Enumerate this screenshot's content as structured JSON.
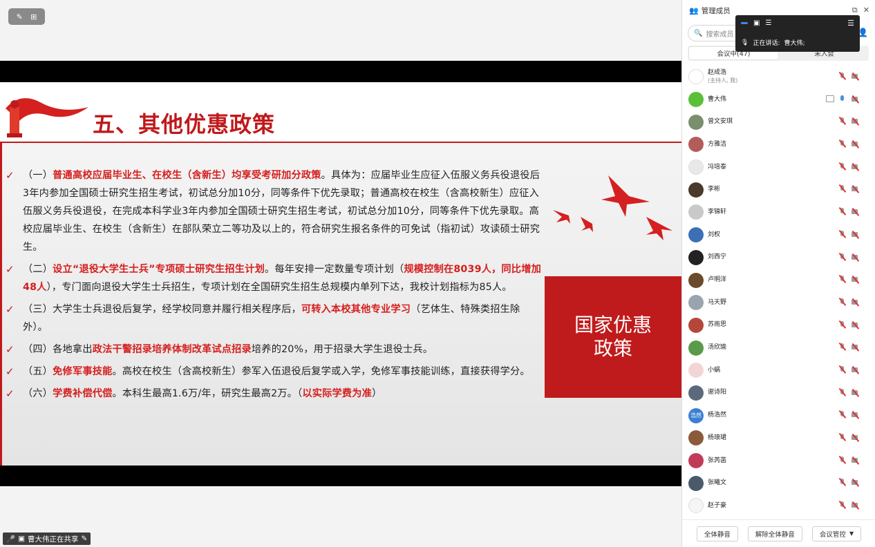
{
  "toolbar": {
    "icon1": "annotate-icon",
    "icon2": "translate-icon"
  },
  "slide": {
    "title": "五、其他优惠政策",
    "redbox_text": "国家优惠政策",
    "bullets": [
      {
        "parts": [
          {
            "t": "（一）",
            "s": ""
          },
          {
            "t": "普通高校应届毕业生、在校生（含新生）均享受考研加分政策",
            "s": "red"
          },
          {
            "t": "。具体为：应届毕业生应征入伍服义务兵役退役后3年内参加全国硕士研究生招生考试，初试总分加10分，同等条件下优先录取；普通高校在校生（含高校新生）应征入伍服义务兵役退役，在完成本科学业3年内参加全国硕士研究生招生考试，初试总分加10分，同等条件下优先录取。高校应届毕业生、在校生（含新生）在部队荣立二等功及以上的，符合研究生报名条件的可免试（指初试）攻读硕士研究生。",
            "s": ""
          }
        ]
      },
      {
        "parts": [
          {
            "t": "（二）",
            "s": ""
          },
          {
            "t": "设立“退役大学生士兵”专项硕士研究生招生计划",
            "s": "red"
          },
          {
            "t": "。每年安排一定数量专项计划（",
            "s": ""
          },
          {
            "t": "规模控制在8039人，同比增加48人",
            "s": "red"
          },
          {
            "t": "），专门面向退役大学生士兵招生，专项计划在全国研究生招生总规模内单列下达，我校计划指标为85人。",
            "s": ""
          }
        ]
      },
      {
        "parts": [
          {
            "t": "（三）大学生士兵退役后复学，经学校同意并履行相关程序后，",
            "s": ""
          },
          {
            "t": "可转入本校其他专业学习",
            "s": "red"
          },
          {
            "t": "（艺体生、特殊类招生除外）。",
            "s": ""
          }
        ]
      },
      {
        "parts": [
          {
            "t": "（四）各地拿出",
            "s": ""
          },
          {
            "t": "政法干警招录培养体制改革试点招录",
            "s": "red"
          },
          {
            "t": "培养的20%，用于招录大学生退役士兵。",
            "s": ""
          }
        ]
      },
      {
        "parts": [
          {
            "t": "（五）",
            "s": ""
          },
          {
            "t": "免修军事技能",
            "s": "red"
          },
          {
            "t": "。高校在校生（含高校新生）参军入伍退役后复学或入学，免修军事技能训练，直接获得学分。",
            "s": ""
          }
        ]
      },
      {
        "parts": [
          {
            "t": "（六）",
            "s": ""
          },
          {
            "t": "学费补偿代偿",
            "s": "red"
          },
          {
            "t": "。本科生最高1.6万/年，研究生最高2万。（",
            "s": ""
          },
          {
            "t": "以实际学费为准",
            "s": "red"
          },
          {
            "t": "）",
            "s": ""
          }
        ]
      }
    ]
  },
  "share_status": "曹大伟正在共享",
  "panel": {
    "title": "管理成员",
    "search_placeholder": "搜索成员",
    "tab_in_meeting": "会议中(47)",
    "tab_not_joined": "未入会",
    "members": [
      {
        "name": "赵成浩",
        "sub": "(主持人, 我)",
        "avatar_color": "#ffffff",
        "avatar_text": "",
        "mic": "off",
        "screen": false
      },
      {
        "name": "曹大伟",
        "sub": "",
        "avatar_color": "#5bbf3a",
        "avatar_text": "",
        "mic": "on",
        "screen": true
      },
      {
        "name": "曾文安琪",
        "sub": "",
        "avatar_color": "#7a8f6e",
        "avatar_text": "",
        "mic": "off",
        "screen": false
      },
      {
        "name": "方雅洁",
        "sub": "",
        "avatar_color": "#b45b5b",
        "avatar_text": "",
        "mic": "off",
        "screen": false
      },
      {
        "name": "冯培泰",
        "sub": "",
        "avatar_color": "#e8e8e8",
        "avatar_text": "",
        "mic": "off",
        "screen": false
      },
      {
        "name": "李彬",
        "sub": "",
        "avatar_color": "#4a3a2a",
        "avatar_text": "",
        "mic": "off",
        "screen": false
      },
      {
        "name": "李锦轩",
        "sub": "",
        "avatar_color": "#c9c9c9",
        "avatar_text": "",
        "mic": "off",
        "screen": false
      },
      {
        "name": "刘权",
        "sub": "",
        "avatar_color": "#3d6fb5",
        "avatar_text": "",
        "mic": "off",
        "screen": false
      },
      {
        "name": "刘西宁",
        "sub": "",
        "avatar_color": "#222222",
        "avatar_text": "",
        "mic": "off",
        "screen": false
      },
      {
        "name": "卢明洋",
        "sub": "",
        "avatar_color": "#6b4b2b",
        "avatar_text": "",
        "mic": "off",
        "screen": false
      },
      {
        "name": "马天野",
        "sub": "",
        "avatar_color": "#9aa4ae",
        "avatar_text": "",
        "mic": "off",
        "screen": false
      },
      {
        "name": "苏雨思",
        "sub": "",
        "avatar_color": "#b5473a",
        "avatar_text": "",
        "mic": "off",
        "screen": false
      },
      {
        "name": "汤欣瑜",
        "sub": "",
        "avatar_color": "#5a9a4a",
        "avatar_text": "",
        "mic": "off",
        "screen": false
      },
      {
        "name": "小蜗",
        "sub": "",
        "avatar_color": "#f2d6d6",
        "avatar_text": "",
        "mic": "off",
        "screen": false
      },
      {
        "name": "谢诗阳",
        "sub": "",
        "avatar_color": "#5a6a7a",
        "avatar_text": "",
        "mic": "off",
        "screen": false
      },
      {
        "name": "杨浩然",
        "sub": "",
        "avatar_color": "#3b7fd4",
        "avatar_text": "浩然",
        "mic": "off",
        "screen": false
      },
      {
        "name": "杨琅珺",
        "sub": "",
        "avatar_color": "#8a5a3a",
        "avatar_text": "",
        "mic": "off",
        "screen": false
      },
      {
        "name": "张芮菡",
        "sub": "",
        "avatar_color": "#c23a5a",
        "avatar_text": "",
        "mic": "off",
        "screen": false
      },
      {
        "name": "张曦文",
        "sub": "",
        "avatar_color": "#4a5a6a",
        "avatar_text": "",
        "mic": "off",
        "screen": false
      },
      {
        "name": "赵子豪",
        "sub": "",
        "avatar_color": "#f5f5f5",
        "avatar_text": "",
        "mic": "off",
        "screen": false
      }
    ],
    "footer": {
      "mute_all": "全体静音",
      "unmute_all": "解除全体静音",
      "control": "会议管控"
    }
  },
  "speaker_popup": {
    "label": "正在讲话:",
    "name": "曹大伟;"
  },
  "colors": {
    "accent_red": "#c0191b",
    "highlight_red": "#d61e1e",
    "blue": "#3c8dde"
  }
}
